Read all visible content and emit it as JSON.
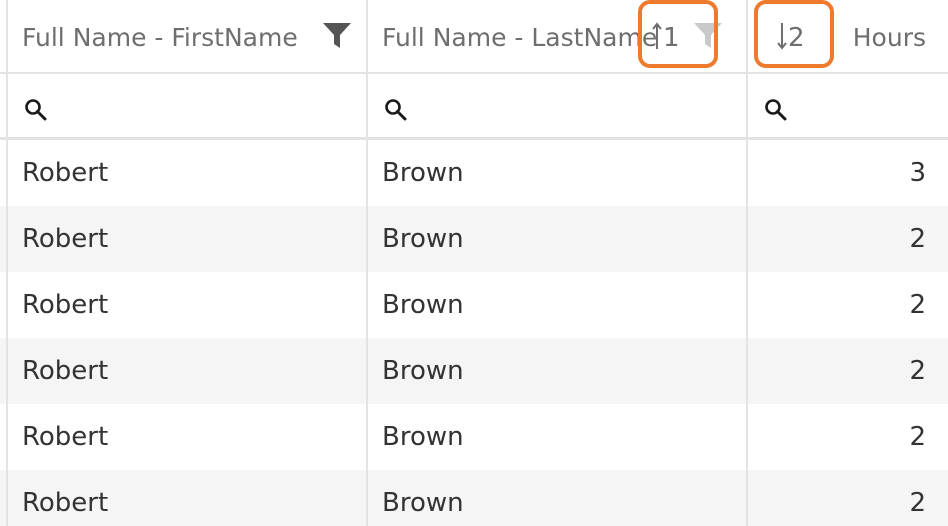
{
  "columns": [
    {
      "header": "Full Name - FirstName",
      "filter_icon": "funnel-icon"
    },
    {
      "header": "Full Name - LastName",
      "sort": {
        "direction": "ascending",
        "order": "1"
      },
      "filter_icon": "funnel-icon"
    },
    {
      "header": "Hours",
      "sort": {
        "direction": "descending",
        "order": "2"
      }
    }
  ],
  "filter_row": {
    "icon": "search-icon"
  },
  "highlight_color": "#ee7a2d",
  "rows": [
    {
      "first": "Robert",
      "last": "Brown",
      "hours": "3"
    },
    {
      "first": "Robert",
      "last": "Brown",
      "hours": "2"
    },
    {
      "first": "Robert",
      "last": "Brown",
      "hours": "2"
    },
    {
      "first": "Robert",
      "last": "Brown",
      "hours": "2"
    },
    {
      "first": "Robert",
      "last": "Brown",
      "hours": "2"
    },
    {
      "first": "Robert",
      "last": "Brown",
      "hours": "2"
    }
  ]
}
